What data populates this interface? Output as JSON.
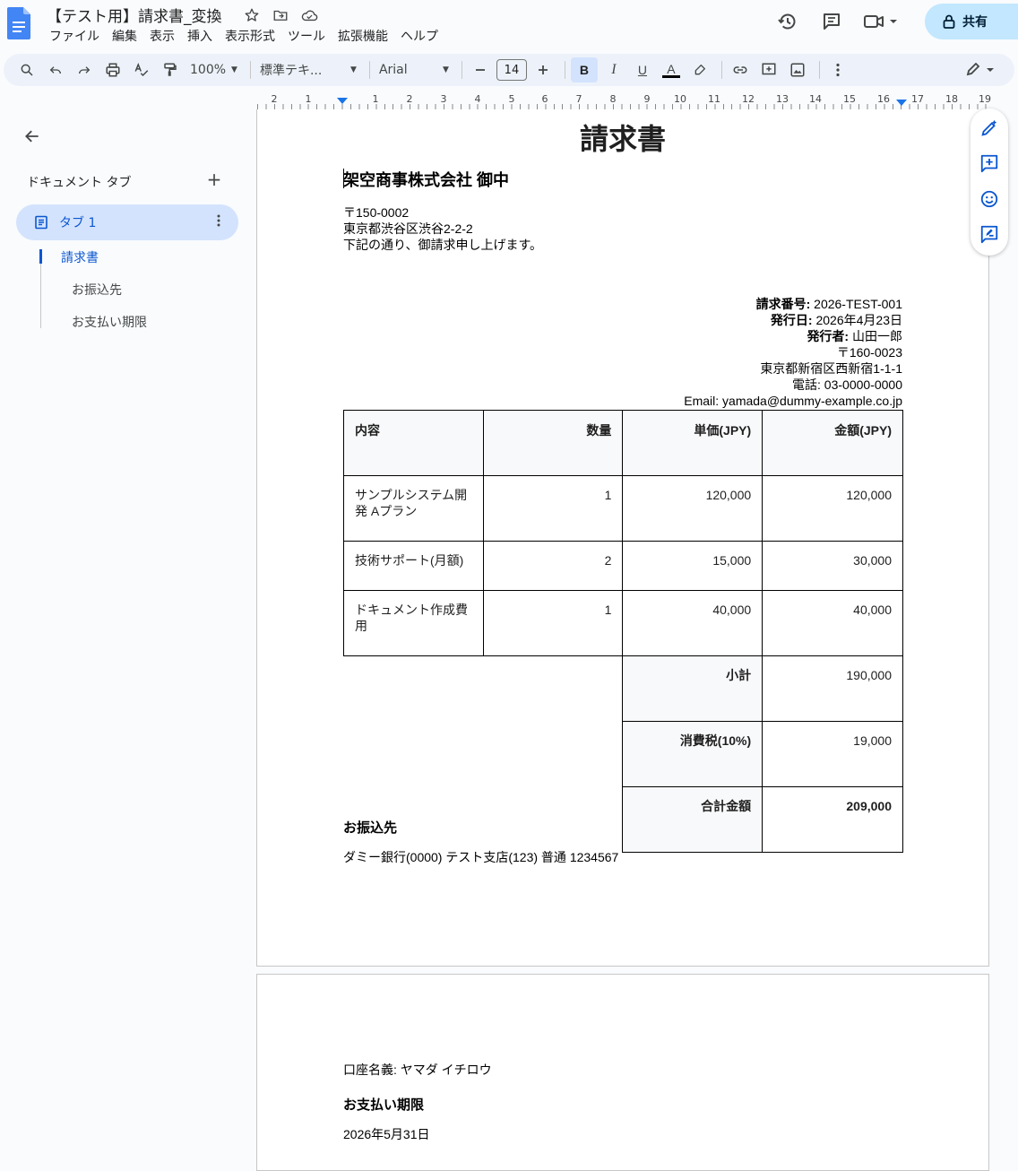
{
  "app": {
    "doc_title": "【テスト用】請求書_変換",
    "menu": [
      "ファイル",
      "編集",
      "表示",
      "挿入",
      "表示形式",
      "ツール",
      "拡張機能",
      "ヘルプ"
    ],
    "share_label": "共有"
  },
  "toolbar": {
    "zoom": "100%",
    "style": "標準テキ...",
    "font": "Arial",
    "font_size": "14",
    "bold_label": "B",
    "italic_label": "I",
    "underline_label": "U",
    "text_color_label": "A"
  },
  "ruler": {
    "labels": [
      "2",
      "1",
      "1",
      "2",
      "3",
      "4",
      "5",
      "6",
      "7",
      "8",
      "9",
      "10",
      "11",
      "12",
      "13",
      "14",
      "15",
      "16",
      "17",
      "18",
      "19"
    ]
  },
  "sidebar": {
    "heading": "ドキュメント タブ",
    "add_symbol": "+",
    "tab_label": "タブ 1",
    "outline": [
      "請求書",
      "お振込先",
      "お支払い期限"
    ]
  },
  "document": {
    "title": "請求書",
    "recipient": "架空商事株式会社 御中",
    "recipient_address": [
      "〒150-0002",
      "東京都渋谷区渋谷2-2-2",
      "下記の通り、御請求申し上げます。"
    ],
    "issuer": {
      "invoice_no_label": "請求番号:",
      "invoice_no": " 2026-TEST-001",
      "issue_date_label": "発行日:",
      "issue_date": " 2026年4月23日",
      "issuer_label": "発行者:",
      "issuer_name": " 山田一郎",
      "postal": "〒160-0023",
      "address": "東京都新宿区西新宿1-1-1",
      "phone": "電話: 03-0000-0000",
      "email": "Email: yamada@dummy-example.co.jp"
    },
    "table": {
      "headers": [
        "内容",
        "数量",
        "単価(JPY)",
        "金額(JPY)"
      ],
      "rows": [
        [
          "サンプルシステム開発 Aプラン",
          "1",
          "120,000",
          "120,000"
        ],
        [
          "技術サポート(月額)",
          "2",
          "15,000",
          "30,000"
        ],
        [
          "ドキュメント作成費用",
          "1",
          "40,000",
          "40,000"
        ]
      ],
      "subtotal_label": "小計",
      "subtotal": "190,000",
      "tax_label": "消費税(10%)",
      "tax": "19,000",
      "total_label": "合計金額",
      "total": "209,000"
    },
    "bank_heading": "お振込先",
    "bank_info": "ダミー銀行(0000) テスト支店(123) 普通 1234567",
    "account_name": "口座名義: ヤマダ イチロウ",
    "due_heading": "お支払い期限",
    "due_date": "2026年5月31日"
  }
}
